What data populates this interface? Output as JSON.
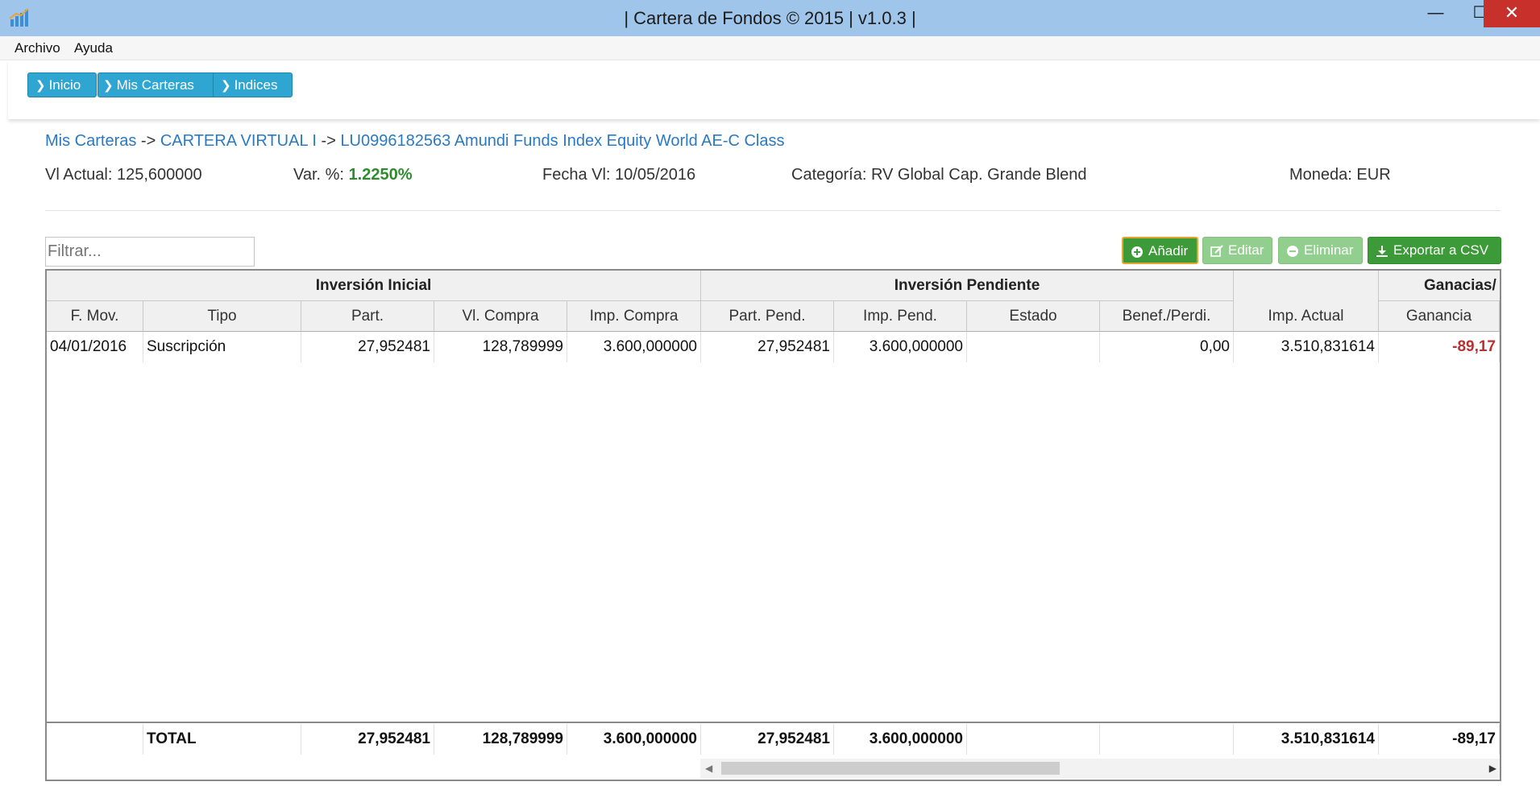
{
  "window": {
    "title": "| Cartera de Fondos © 2015 | v1.0.3 |",
    "minimize_glyph": "—",
    "maximize_glyph": "☐",
    "close_glyph": "✕"
  },
  "menu": [
    "Archivo",
    "Ayuda"
  ],
  "nav": [
    "Inicio",
    "Mis Carteras",
    "Indices"
  ],
  "breadcrumb": {
    "root": "Mis Carteras",
    "portfolio": "CARTERA VIRTUAL I",
    "fund": "LU0996182563 Amundi Funds Index Equity World AE-C Class",
    "separator": "->"
  },
  "info": {
    "vl_actual_label": "Vl Actual:",
    "vl_actual": "125,600000",
    "var_label": "Var. %:",
    "var": "1.2250%",
    "fecha_label": "Fecha Vl:",
    "fecha": "10/05/2016",
    "categoria_label": "Categoría:",
    "categoria": "RV Global Cap. Grande Blend",
    "moneda_label": "Moneda:",
    "moneda": "EUR"
  },
  "filter": {
    "placeholder": "Filtrar..."
  },
  "actions": {
    "add": "Añadir",
    "edit": "Editar",
    "delete": "Eliminar",
    "export": "Exportar a CSV"
  },
  "table": {
    "groups": [
      "Inversión Inicial",
      "Inversión Pendiente",
      "Ganacias/"
    ],
    "columns": [
      "F. Mov.",
      "Tipo",
      "Part.",
      "Vl. Compra",
      "Imp. Compra",
      "Part. Pend.",
      "Imp. Pend.",
      "Estado",
      "Benef./Perdi.",
      "Imp. Actual",
      "Ganancia"
    ],
    "rows": [
      [
        "04/01/2016",
        "Suscripción",
        "27,952481",
        "128,789999",
        "3.600,000000",
        "27,952481",
        "3.600,000000",
        "",
        "0,00",
        "3.510,831614",
        "-89,17"
      ]
    ],
    "totals": [
      "",
      "TOTAL",
      "27,952481",
      "128,789999",
      "3.600,000000",
      "27,952481",
      "3.600,000000",
      "",
      "",
      "3.510,831614",
      "-89,17"
    ]
  },
  "colors": {
    "nav_button": "#2fa6d1",
    "add_button": "#3c9a39",
    "disabled_button": "#92cf8f",
    "link": "#2a79c4",
    "positive": "#2e8b2e",
    "negative": "#b83232",
    "close_button": "#c7302b"
  }
}
